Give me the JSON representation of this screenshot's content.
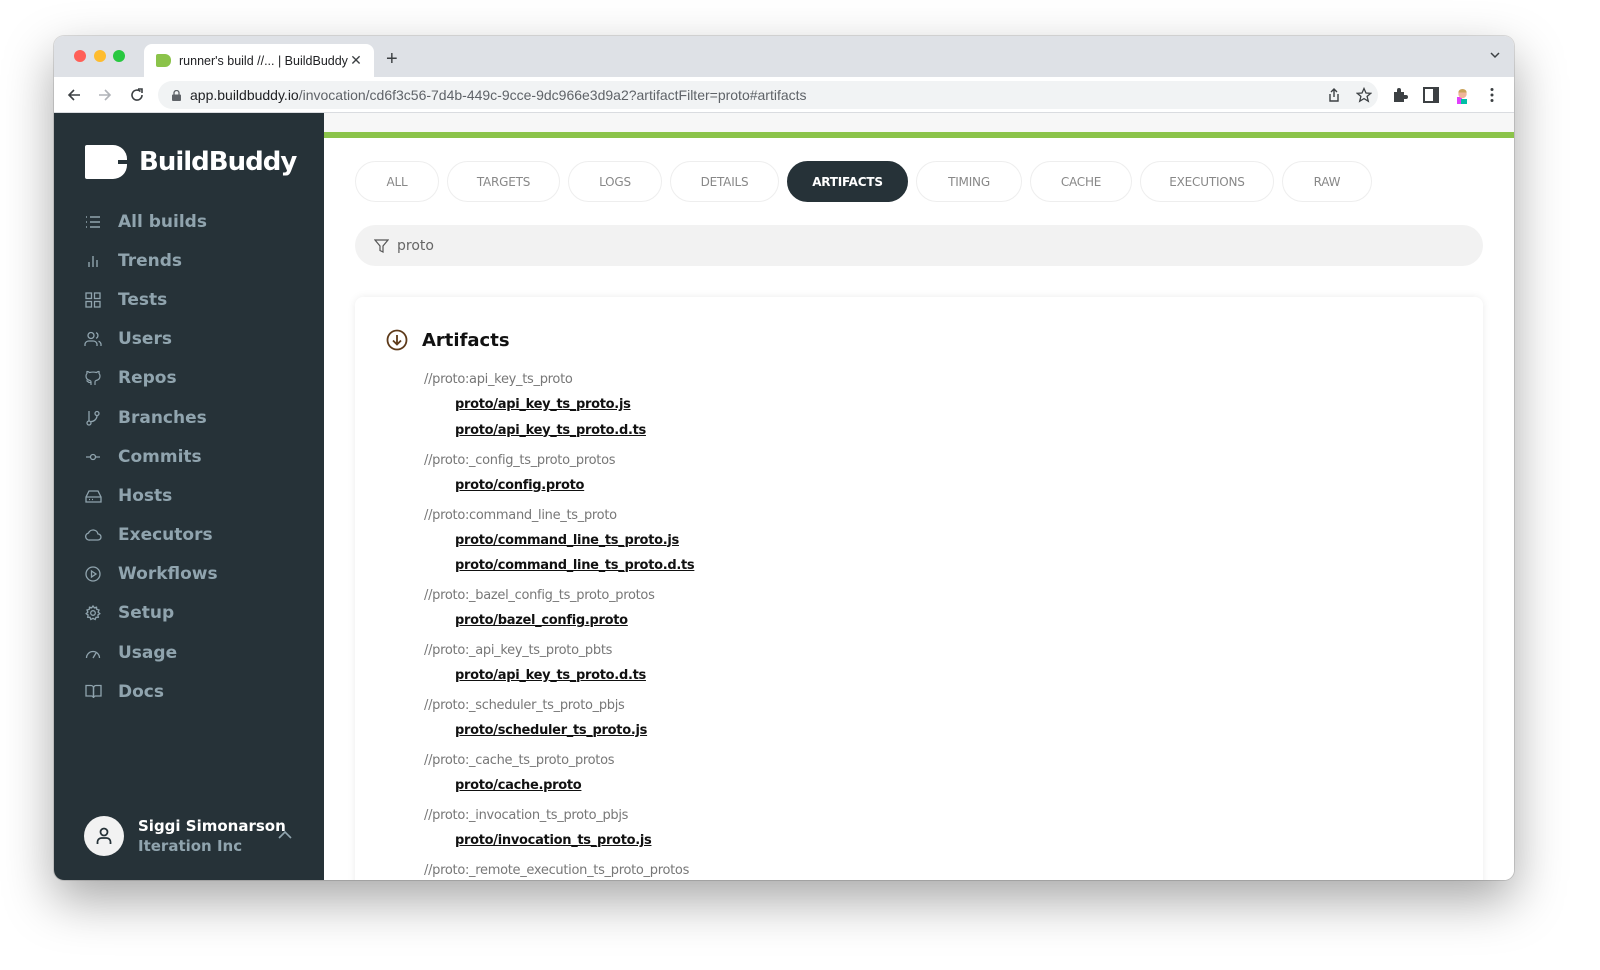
{
  "browser": {
    "tab_title": "runner's build //... | BuildBuddy",
    "url_host": "app.buildbuddy.io",
    "url_path": "/invocation/cd6f3c56-7d4b-449c-9cce-9dc966e3d9a2?artifactFilter=proto#artifacts",
    "icons": [
      "back-icon",
      "forward-icon",
      "reload-icon",
      "lock-icon",
      "share-icon",
      "bookmark-star-icon",
      "extensions-icon",
      "side-panel-icon",
      "profile-avatar",
      "more-menu-icon"
    ]
  },
  "sidebar": {
    "brand": "BuildBuddy",
    "items": [
      {
        "label": "All builds",
        "icon": "list-icon"
      },
      {
        "label": "Trends",
        "icon": "bar-chart-icon"
      },
      {
        "label": "Tests",
        "icon": "grid-icon"
      },
      {
        "label": "Users",
        "icon": "users-icon"
      },
      {
        "label": "Repos",
        "icon": "github-icon"
      },
      {
        "label": "Branches",
        "icon": "git-branch-icon"
      },
      {
        "label": "Commits",
        "icon": "git-commit-icon"
      },
      {
        "label": "Hosts",
        "icon": "hard-drive-icon"
      },
      {
        "label": "Executors",
        "icon": "cloud-icon"
      },
      {
        "label": "Workflows",
        "icon": "play-circle-icon"
      },
      {
        "label": "Setup",
        "icon": "settings-icon"
      },
      {
        "label": "Usage",
        "icon": "gauge-icon"
      },
      {
        "label": "Docs",
        "icon": "book-icon"
      }
    ],
    "user": {
      "name": "Siggi Simonarson",
      "org": "Iteration Inc"
    }
  },
  "main": {
    "progress_percent": 100,
    "colors": {
      "progress": "#8bc34a",
      "sidebar": "#263238",
      "active_tab": "#263238",
      "artifacts_icon": "#5d3a1a"
    },
    "tabs": [
      {
        "label": "ALL",
        "active": false
      },
      {
        "label": "TARGETS",
        "active": false
      },
      {
        "label": "LOGS",
        "active": false
      },
      {
        "label": "DETAILS",
        "active": false
      },
      {
        "label": "ARTIFACTS",
        "active": true
      },
      {
        "label": "TIMING",
        "active": false
      },
      {
        "label": "CACHE",
        "active": false
      },
      {
        "label": "EXECUTIONS",
        "active": false
      },
      {
        "label": "RAW",
        "active": false
      }
    ],
    "filter": {
      "value": "proto",
      "icon": "filter-icon"
    },
    "artifacts": {
      "title": "Artifacts",
      "groups": [
        {
          "target": "//proto:api_key_ts_proto",
          "files": [
            "proto/api_key_ts_proto.js",
            "proto/api_key_ts_proto.d.ts"
          ]
        },
        {
          "target": "//proto:_config_ts_proto_protos",
          "files": [
            "proto/config.proto"
          ]
        },
        {
          "target": "//proto:command_line_ts_proto",
          "files": [
            "proto/command_line_ts_proto.js",
            "proto/command_line_ts_proto.d.ts"
          ]
        },
        {
          "target": "//proto:_bazel_config_ts_proto_protos",
          "files": [
            "proto/bazel_config.proto"
          ]
        },
        {
          "target": "//proto:_api_key_ts_proto_pbts",
          "files": [
            "proto/api_key_ts_proto.d.ts"
          ]
        },
        {
          "target": "//proto:_scheduler_ts_proto_pbjs",
          "files": [
            "proto/scheduler_ts_proto.js"
          ]
        },
        {
          "target": "//proto:_cache_ts_proto_protos",
          "files": [
            "proto/cache.proto"
          ]
        },
        {
          "target": "//proto:_invocation_ts_proto_pbjs",
          "files": [
            "proto/invocation_ts_proto.js"
          ]
        },
        {
          "target": "//proto:_remote_execution_ts_proto_protos",
          "files": []
        }
      ]
    }
  }
}
